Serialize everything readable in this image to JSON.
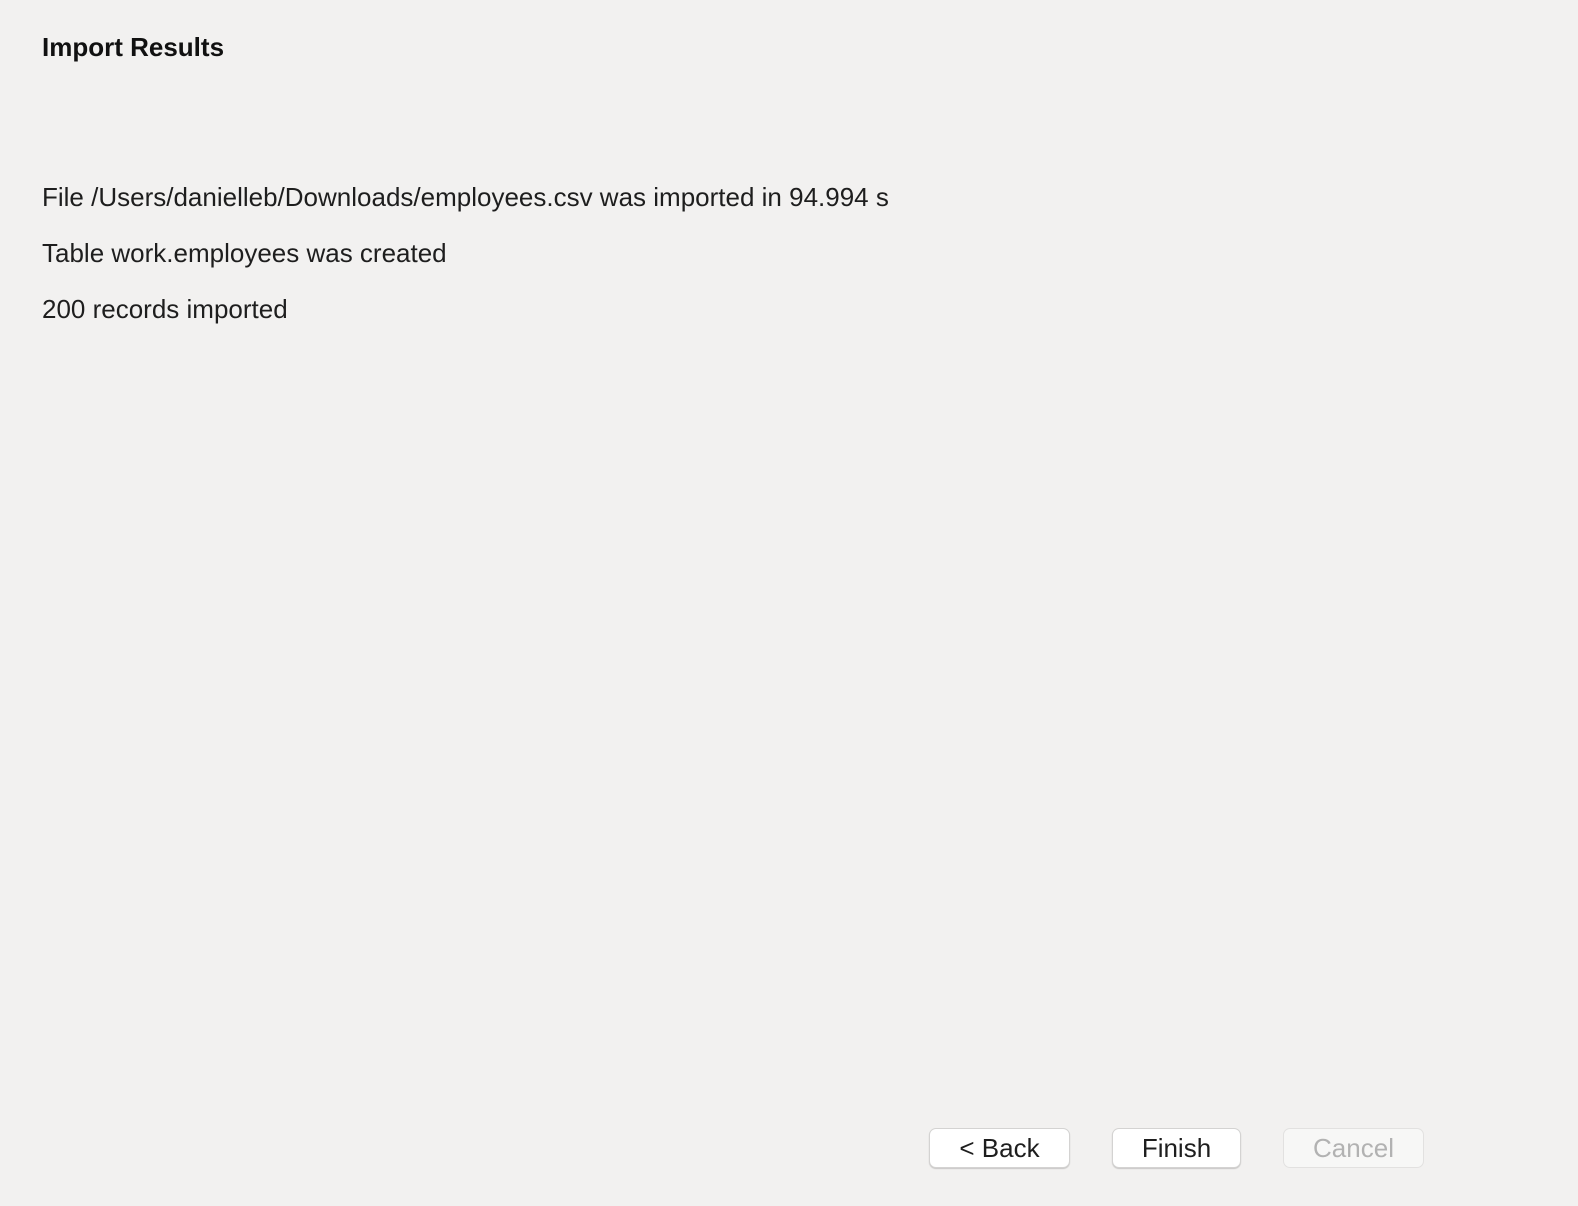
{
  "header": {
    "title": "Import Results"
  },
  "results": {
    "lines": [
      "File /Users/danielleb/Downloads/employees.csv was imported in 94.994 s",
      "Table work.employees was created",
      "200 records imported"
    ]
  },
  "footer": {
    "back_label": "< Back",
    "finish_label": "Finish",
    "cancel_label": "Cancel",
    "cancel_disabled": true
  }
}
